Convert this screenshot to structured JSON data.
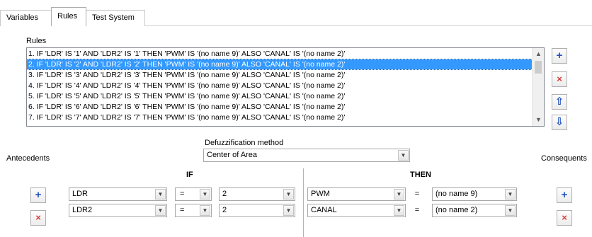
{
  "tabs": [
    {
      "label": "Variables"
    },
    {
      "label": "Rules"
    },
    {
      "label": "Test System"
    }
  ],
  "rules_section": {
    "title": "Rules",
    "items": [
      "1. IF 'LDR' IS '1' AND 'LDR2' IS '1' THEN 'PWM' IS '(no name 9)' ALSO 'CANAL' IS '(no name 2)'",
      "2. IF 'LDR' IS '2' AND 'LDR2' IS '2' THEN 'PWM' IS '(no name 9)' ALSO 'CANAL' IS '(no name 2)'",
      "3. IF 'LDR' IS '3' AND 'LDR2' IS '3' THEN 'PWM' IS '(no name 9)' ALSO 'CANAL' IS '(no name 2)'",
      "4. IF 'LDR' IS '4' AND 'LDR2' IS '4' THEN 'PWM' IS '(no name 9)' ALSO 'CANAL' IS '(no name 2)'",
      "5. IF 'LDR' IS '5' AND 'LDR2' IS '5' THEN 'PWM' IS '(no name 9)' ALSO 'CANAL' IS '(no name 2)'",
      "6. IF 'LDR' IS '6' AND 'LDR2' IS '6' THEN 'PWM' IS '(no name 9)' ALSO 'CANAL' IS '(no name 2)'",
      "7. IF 'LDR' IS '7' AND 'LDR2' IS '7' THEN 'PWM' IS '(no name 9)' ALSO 'CANAL' IS '(no name 2)'"
    ],
    "selected_index": 1
  },
  "side_buttons": {
    "add": "+",
    "remove": "×",
    "up": "⇧",
    "down": "⇩"
  },
  "defuzz": {
    "label": "Defuzzification method",
    "value": "Center of Area"
  },
  "antecedents": {
    "label": "Antecedents",
    "header": "IF",
    "rows": [
      {
        "variable": "LDR",
        "operator": "=",
        "value": "2"
      },
      {
        "variable": "LDR2",
        "operator": "=",
        "value": "2"
      }
    ]
  },
  "consequents": {
    "label": "Consequents",
    "header": "THEN",
    "rows": [
      {
        "variable": "PWM",
        "operator": "=",
        "value": "(no name 9)"
      },
      {
        "variable": "CANAL",
        "operator": "=",
        "value": "(no name 2)"
      }
    ]
  },
  "icons": {
    "dropdown": "chevron-down-icon",
    "scroll_up": "▲",
    "scroll_down": "▼",
    "dd_glyph": "▼"
  },
  "colors": {
    "selection": "#3399ff",
    "add": "#1f4fbf",
    "remove": "#d83b3b"
  }
}
